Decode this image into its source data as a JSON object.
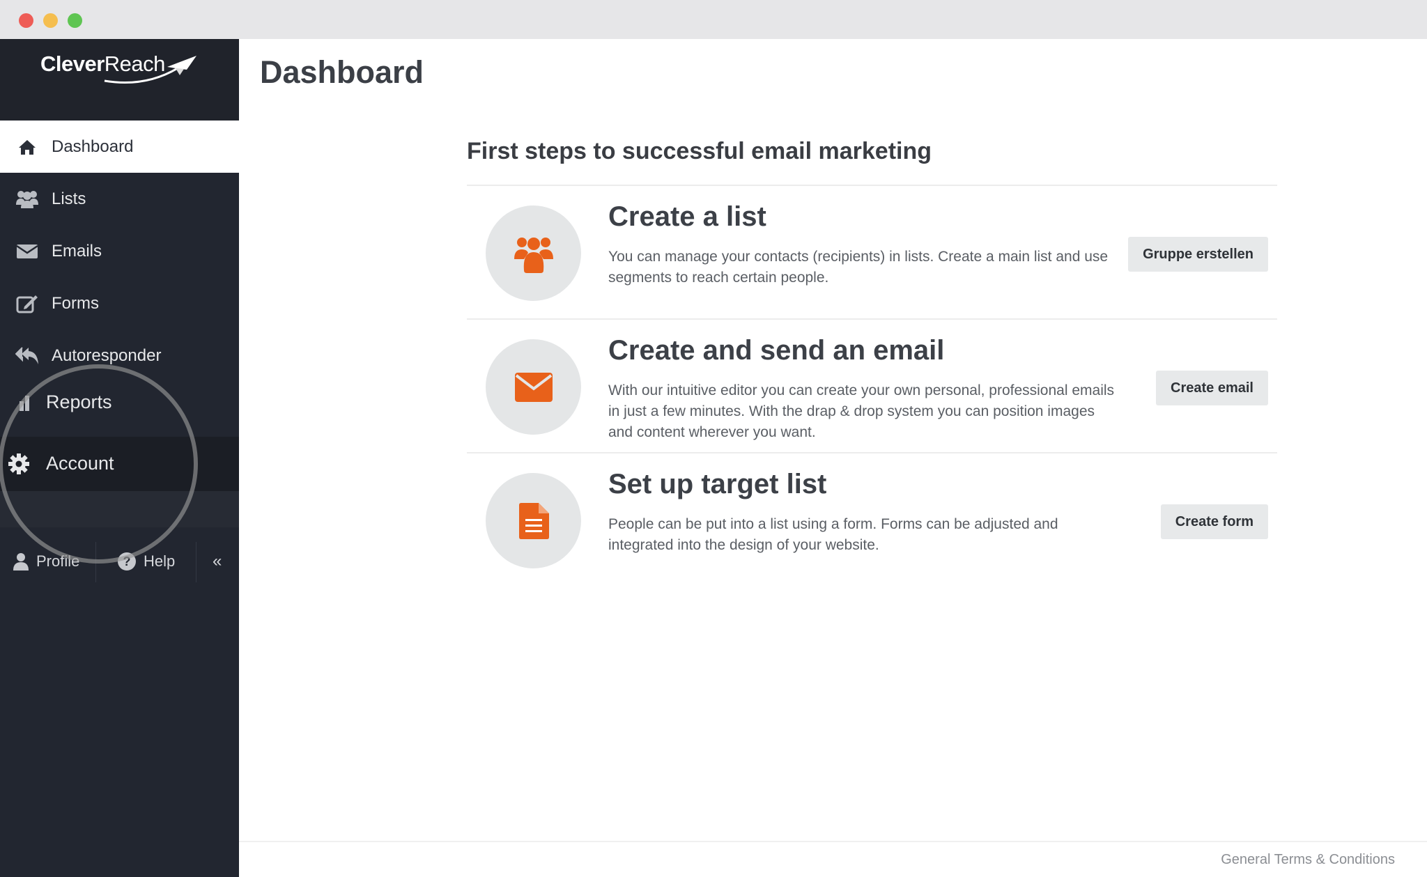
{
  "window": {
    "controls": [
      "close",
      "minimize",
      "maximize"
    ]
  },
  "sidebar": {
    "logo": {
      "bold": "Clever",
      "thin": "Reach"
    },
    "items": [
      {
        "label": "Dashboard",
        "icon": "home-icon",
        "active": true
      },
      {
        "label": "Lists",
        "icon": "users-icon"
      },
      {
        "label": "Emails",
        "icon": "envelope-icon"
      },
      {
        "label": "Forms",
        "icon": "edit-icon"
      },
      {
        "label": "Autoresponder",
        "icon": "reply-all-icon"
      },
      {
        "label": "Reports",
        "icon": "bar-chart-icon"
      },
      {
        "label": "Account",
        "icon": "gear-icon"
      }
    ],
    "bottom": {
      "profile_label": "Profile",
      "help_label": "Help",
      "collapse_label": "«"
    }
  },
  "main": {
    "title": "Dashboard",
    "section_title": "First steps to successful email marketing",
    "steps": [
      {
        "title": "Create a list",
        "description": "You can manage your contacts (recipients) in lists. Create a main list and use segments to reach certain people.",
        "button": "Gruppe erstellen",
        "icon": "users-icon"
      },
      {
        "title": "Create and send an email",
        "description": "With our intuitive editor you can create your own personal, professional emails in just a few minutes. With the drap & drop system you can position images and content wherever you want.",
        "button": "Create email",
        "icon": "envelope-icon"
      },
      {
        "title": "Set up target list",
        "description": "People can be put into a list using a form. Forms can be adjusted and integrated into the design of your website.",
        "button": "Create form",
        "icon": "document-icon"
      }
    ],
    "footer_link": "General Terms & Conditions"
  },
  "colors": {
    "sidebar_bg": "#222630",
    "accent_orange": "#e8611a",
    "icon_circle": "#e4e6e7"
  }
}
